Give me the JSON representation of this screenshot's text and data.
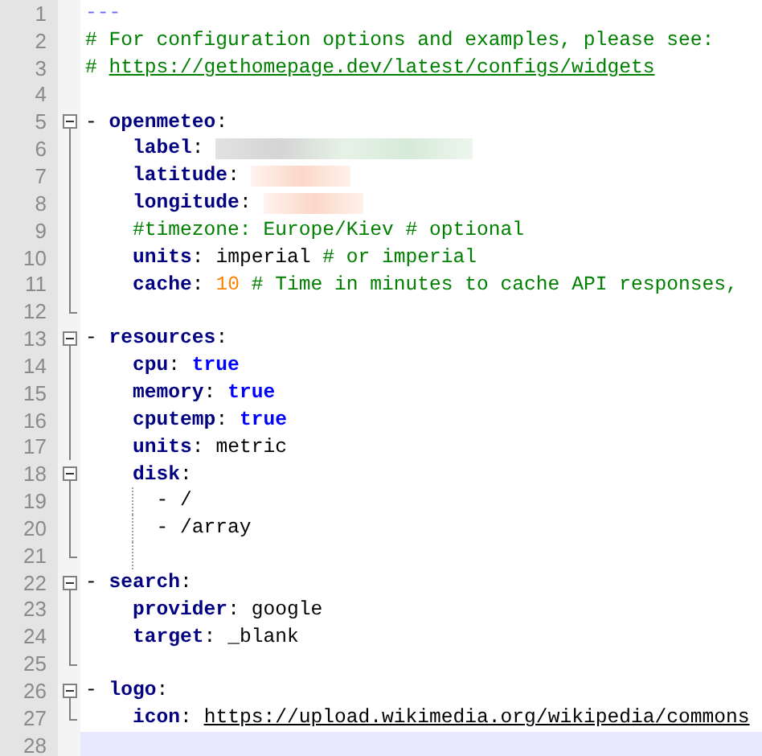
{
  "editor": {
    "lines": [
      {
        "number": "1",
        "current": false,
        "indent_guide": false,
        "tokens": [
          {
            "kind": "doc",
            "text": "---"
          }
        ]
      },
      {
        "number": "2",
        "current": false,
        "indent_guide": false,
        "tokens": [
          {
            "kind": "comment",
            "text": "# For configuration options and examples, please see:"
          }
        ]
      },
      {
        "number": "3",
        "current": false,
        "indent_guide": false,
        "tokens": [
          {
            "kind": "comment",
            "text": "# "
          },
          {
            "kind": "comment_link",
            "text": "https://gethomepage.dev/latest/configs/widgets"
          }
        ]
      },
      {
        "number": "4",
        "current": false,
        "indent_guide": false
      },
      {
        "number": "5",
        "fold": {
          "kind": "open"
        },
        "current": false,
        "indent_guide": false,
        "tokens": [
          {
            "kind": "plain",
            "text": "- "
          },
          {
            "kind": "key",
            "text": "openmeteo"
          },
          {
            "kind": "punct",
            "text": ":"
          }
        ]
      },
      {
        "number": "6",
        "fold": {
          "kind": "line"
        },
        "current": false,
        "indent_guide": false,
        "tokens": [
          {
            "kind": "key",
            "text": "    label"
          },
          {
            "kind": "punct",
            "text": ": "
          },
          {
            "kind": "redacted_long"
          }
        ]
      },
      {
        "number": "7",
        "fold": {
          "kind": "line"
        },
        "current": false,
        "indent_guide": false,
        "tokens": [
          {
            "kind": "key",
            "text": "    latitude"
          },
          {
            "kind": "punct",
            "text": ": "
          },
          {
            "kind": "redacted_short"
          }
        ]
      },
      {
        "number": "8",
        "fold": {
          "kind": "line"
        },
        "current": false,
        "indent_guide": false,
        "tokens": [
          {
            "kind": "key",
            "text": "    longitude"
          },
          {
            "kind": "punct",
            "text": ": "
          },
          {
            "kind": "redacted_short"
          }
        ]
      },
      {
        "number": "9",
        "fold": {
          "kind": "line"
        },
        "current": false,
        "indent_guide": false,
        "tokens": [
          {
            "kind": "comment",
            "text": "    #timezone: Europe/Kiev # optional"
          }
        ]
      },
      {
        "number": "10",
        "fold": {
          "kind": "line"
        },
        "current": false,
        "indent_guide": false,
        "tokens": [
          {
            "kind": "key",
            "text": "    units"
          },
          {
            "kind": "punct",
            "text": ": "
          },
          {
            "kind": "plain",
            "text": "imperial "
          },
          {
            "kind": "comment",
            "text": "# or imperial"
          }
        ]
      },
      {
        "number": "11",
        "fold": {
          "kind": "line"
        },
        "current": false,
        "indent_guide": false,
        "tokens": [
          {
            "kind": "key",
            "text": "    cache"
          },
          {
            "kind": "punct",
            "text": ": "
          },
          {
            "kind": "number",
            "text": "10 "
          },
          {
            "kind": "comment",
            "text": "# Time in minutes to cache API responses,"
          }
        ]
      },
      {
        "number": "12",
        "fold": {
          "kind": "end"
        },
        "current": false,
        "indent_guide": false
      },
      {
        "number": "13",
        "fold": {
          "kind": "open"
        },
        "current": false,
        "indent_guide": false,
        "tokens": [
          {
            "kind": "plain",
            "text": "- "
          },
          {
            "kind": "key",
            "text": "resources"
          },
          {
            "kind": "punct",
            "text": ":"
          }
        ]
      },
      {
        "number": "14",
        "fold": {
          "kind": "line"
        },
        "current": false,
        "indent_guide": false,
        "tokens": [
          {
            "kind": "key",
            "text": "    cpu"
          },
          {
            "kind": "punct",
            "text": ": "
          },
          {
            "kind": "bool",
            "text": "true"
          }
        ]
      },
      {
        "number": "15",
        "fold": {
          "kind": "line"
        },
        "current": false,
        "indent_guide": false,
        "tokens": [
          {
            "kind": "key",
            "text": "    memory"
          },
          {
            "kind": "punct",
            "text": ": "
          },
          {
            "kind": "bool",
            "text": "true"
          }
        ]
      },
      {
        "number": "16",
        "fold": {
          "kind": "line"
        },
        "current": false,
        "indent_guide": false,
        "tokens": [
          {
            "kind": "key",
            "text": "    cputemp"
          },
          {
            "kind": "punct",
            "text": ": "
          },
          {
            "kind": "bool",
            "text": "true"
          }
        ]
      },
      {
        "number": "17",
        "fold": {
          "kind": "line"
        },
        "current": false,
        "indent_guide": false,
        "tokens": [
          {
            "kind": "key",
            "text": "    units"
          },
          {
            "kind": "punct",
            "text": ": "
          },
          {
            "kind": "plain",
            "text": "metric"
          }
        ]
      },
      {
        "number": "18",
        "fold": {
          "kind": "open"
        },
        "current": false,
        "indent_guide": false,
        "tokens": [
          {
            "kind": "key",
            "text": "    disk"
          },
          {
            "kind": "punct",
            "text": ":"
          }
        ]
      },
      {
        "number": "19",
        "fold": {
          "kind": "line"
        },
        "current": false,
        "indent_guide": true,
        "tokens": [
          {
            "kind": "plain",
            "text": "      - /"
          }
        ]
      },
      {
        "number": "20",
        "fold": {
          "kind": "line"
        },
        "current": false,
        "indent_guide": true,
        "tokens": [
          {
            "kind": "plain",
            "text": "      - /array"
          }
        ]
      },
      {
        "number": "21",
        "fold": {
          "kind": "end"
        },
        "current": false,
        "indent_guide": true
      },
      {
        "number": "22",
        "fold": {
          "kind": "open"
        },
        "current": false,
        "indent_guide": false,
        "tokens": [
          {
            "kind": "plain",
            "text": "- "
          },
          {
            "kind": "key",
            "text": "search"
          },
          {
            "kind": "punct",
            "text": ":"
          }
        ]
      },
      {
        "number": "23",
        "fold": {
          "kind": "line"
        },
        "current": false,
        "indent_guide": false,
        "tokens": [
          {
            "kind": "key",
            "text": "    provider"
          },
          {
            "kind": "punct",
            "text": ": "
          },
          {
            "kind": "plain",
            "text": "google"
          }
        ]
      },
      {
        "number": "24",
        "fold": {
          "kind": "line"
        },
        "current": false,
        "indent_guide": false,
        "tokens": [
          {
            "kind": "key",
            "text": "    target"
          },
          {
            "kind": "punct",
            "text": ": "
          },
          {
            "kind": "plain",
            "text": "_blank"
          }
        ]
      },
      {
        "number": "25",
        "fold": {
          "kind": "end"
        },
        "current": false,
        "indent_guide": false
      },
      {
        "number": "26",
        "fold": {
          "kind": "open"
        },
        "current": false,
        "indent_guide": false,
        "tokens": [
          {
            "kind": "plain",
            "text": "- "
          },
          {
            "kind": "key",
            "text": "logo"
          },
          {
            "kind": "punct",
            "text": ":"
          }
        ]
      },
      {
        "number": "27",
        "fold": {
          "kind": "end"
        },
        "current": false,
        "indent_guide": false,
        "tokens": [
          {
            "kind": "key",
            "text": "    icon"
          },
          {
            "kind": "punct",
            "text": ": "
          },
          {
            "kind": "link",
            "text": "https://upload.wikimedia.org/wikipedia/commons"
          }
        ]
      },
      {
        "number": "28",
        "current": true,
        "indent_guide": false
      }
    ]
  }
}
